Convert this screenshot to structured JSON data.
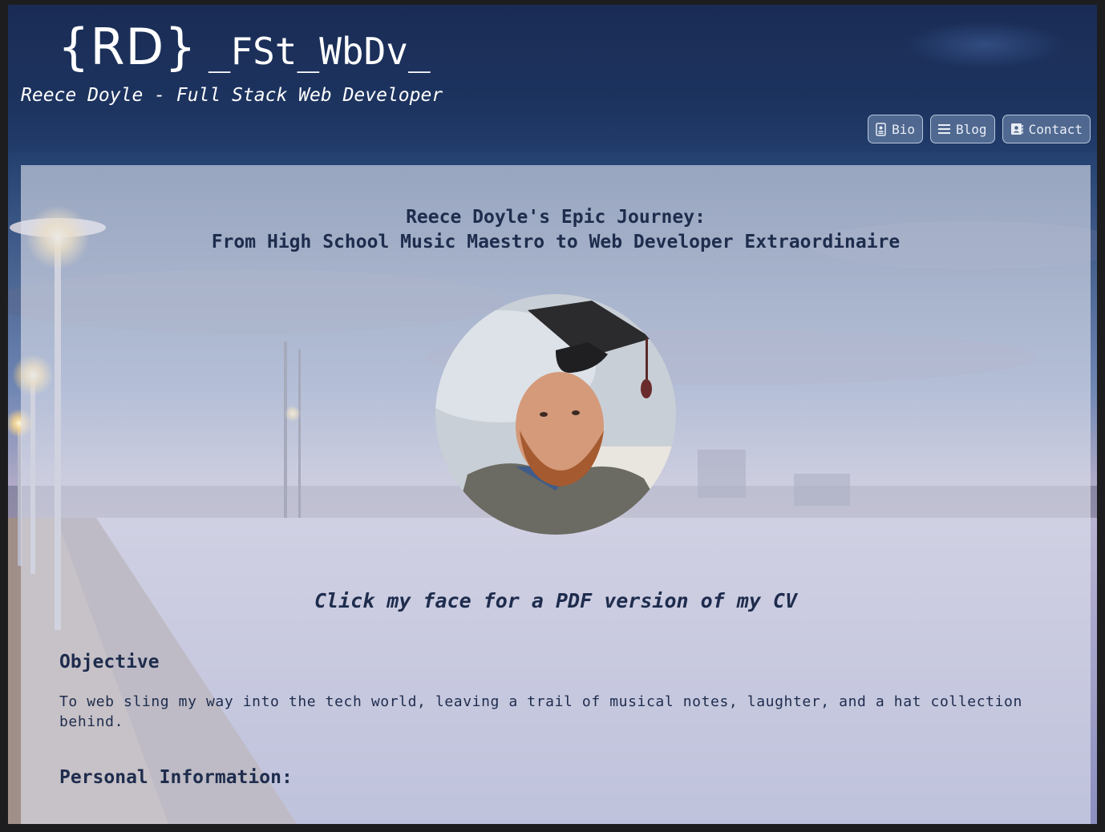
{
  "header": {
    "logo_braces": "{RD}",
    "logo_code": "_FSt_WbDv_",
    "subtitle": "Reece Doyle - Full Stack Web Developer"
  },
  "nav": {
    "items": [
      {
        "label": "Bio",
        "icon": "id-badge-icon"
      },
      {
        "label": "Blog",
        "icon": "menu-lines-icon"
      },
      {
        "label": "Contact",
        "icon": "contact-card-icon"
      }
    ]
  },
  "main": {
    "heading_line1": "Reece Doyle's Epic Journey:",
    "heading_line2": "From High School Music Maestro to Web Developer Extraordinaire",
    "cv_caption": "Click my face for a PDF version of my CV",
    "objective_title": "Objective",
    "objective_text": "To web sling my way into the tech world, leaving a trail of musical notes, laughter, and a hat collection behind.",
    "personal_title": "Personal Information:"
  },
  "colors": {
    "header_bg": "#1d3460",
    "content_text": "#1e2c4d",
    "nav_button_bg": "#7891b4"
  }
}
